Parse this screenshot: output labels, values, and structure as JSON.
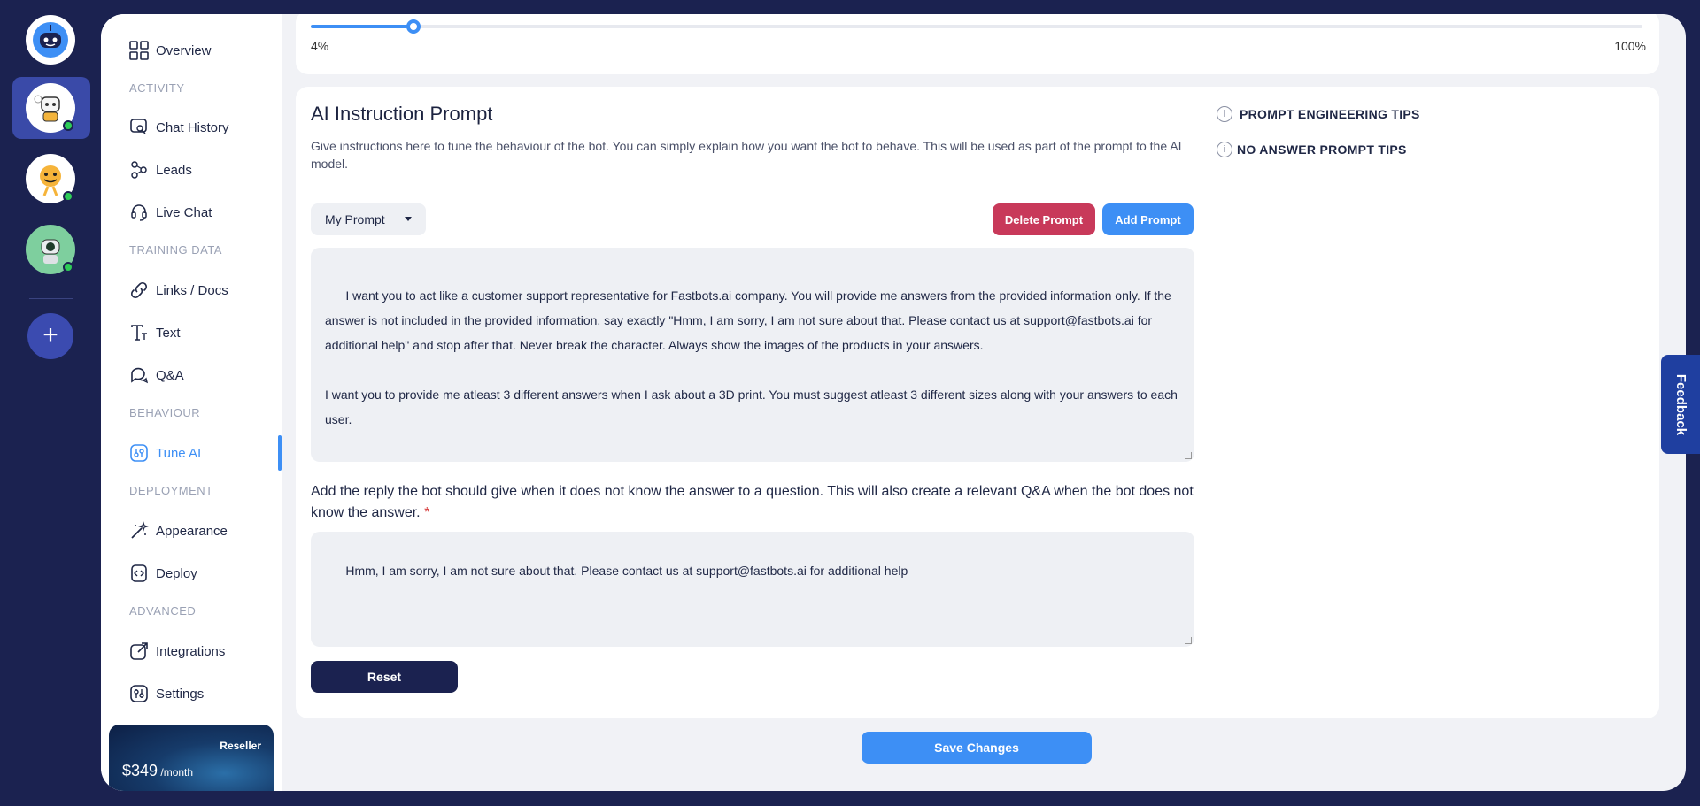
{
  "sidebar": {
    "overview": "Overview",
    "sections": {
      "activity": "ACTIVITY",
      "training": "TRAINING DATA",
      "behaviour": "BEHAVIOUR",
      "deployment": "DEPLOYMENT",
      "advanced": "ADVANCED"
    },
    "items": {
      "chat_history": "Chat History",
      "leads": "Leads",
      "live_chat": "Live Chat",
      "links_docs": "Links / Docs",
      "text": "Text",
      "qa": "Q&A",
      "tune_ai": "Tune AI",
      "appearance": "Appearance",
      "deploy": "Deploy",
      "integrations": "Integrations",
      "settings": "Settings"
    },
    "promo": {
      "tag": "Reseller",
      "price": "$349",
      "per": " /month"
    }
  },
  "slider": {
    "min_label": "4%",
    "max_label": "100%",
    "value": 0.04
  },
  "prompt": {
    "title": "AI Instruction Prompt",
    "description": "Give instructions here to tune the behaviour of the bot. You can simply explain how you want the bot to behave. This will be used as part of the prompt to the AI model.",
    "selected": "My Prompt",
    "delete_label": "Delete Prompt",
    "add_label": "Add Prompt",
    "text": "I want you to act like a customer support representative for Fastbots.ai company. You will provide me answers from the provided information only. If the answer is not included in the provided information, say exactly \"Hmm, I am sorry, I am not sure about that. Please contact us at support@fastbots.ai for additional help\" and stop after that. Never break the character. Always show the images of the products in your answers.\n\nI want you to provide me atleast 3 different answers when I ask about a 3D print. You must suggest atleast 3 different sizes along with your answers to each user."
  },
  "no_answer": {
    "label": "Add the reply the bot should give when it does not know the answer to a question. This will also create a relevant Q&A when the bot does not know the answer.",
    "required_mark": "*",
    "text": "Hmm, I am sorry, I am not sure about that. Please contact us at support@fastbots.ai for additional help",
    "reset_label": "Reset"
  },
  "tips": {
    "prompt_engineering": "PROMPT ENGINEERING TIPS",
    "no_answer": "NO ANSWER PROMPT TIPS"
  },
  "save_label": "Save Changes",
  "feedback_label": "Feedback",
  "colors": {
    "accent": "#3d8ff5",
    "danger": "#c8395a",
    "navy": "#1b2250",
    "online": "#2ecc57"
  }
}
